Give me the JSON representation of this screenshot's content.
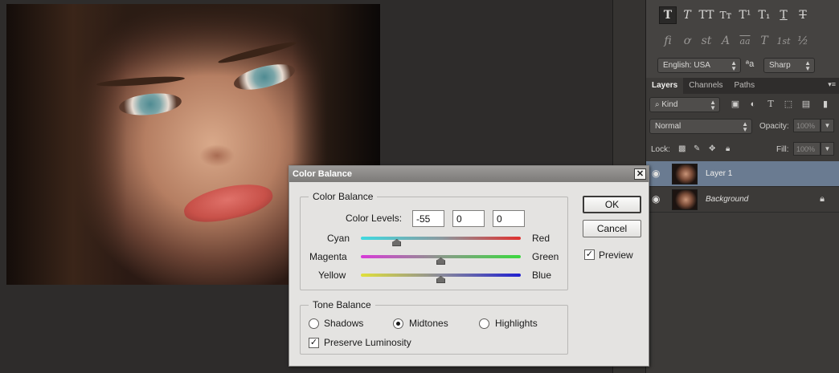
{
  "dialog": {
    "title": "Color Balance",
    "close_glyph": "✕",
    "color_balance_group": "Color Balance",
    "color_levels_label": "Color Levels:",
    "levels": [
      "-55",
      "0",
      "0"
    ],
    "sliders": [
      {
        "left": "Cyan",
        "right": "Red",
        "value": -55,
        "min": -100,
        "max": 100
      },
      {
        "left": "Magenta",
        "right": "Green",
        "value": 0,
        "min": -100,
        "max": 100
      },
      {
        "left": "Yellow",
        "right": "Blue",
        "value": 0,
        "min": -100,
        "max": 100
      }
    ],
    "tone_balance_group": "Tone Balance",
    "tones": {
      "shadows": "Shadows",
      "midtones": "Midtones",
      "highlights": "Highlights",
      "selected": "midtones"
    },
    "preserve_luminosity": "Preserve Luminosity",
    "preserve_luminosity_checked": true,
    "ok": "OK",
    "cancel": "Cancel",
    "preview": "Preview",
    "preview_checked": true
  },
  "character": {
    "row1": [
      "T",
      "T",
      "TT",
      "Tт",
      "T¹",
      "T₁",
      "T",
      "T"
    ],
    "row2": [
      "ﬁ",
      "ơ",
      "st",
      "A",
      "aa",
      "T",
      "1st",
      "½"
    ],
    "language": "English: USA",
    "aa_icon": "ªa",
    "antialias": "Sharp"
  },
  "layers_panel": {
    "tabs": [
      "Layers",
      "Channels",
      "Paths"
    ],
    "menu_glyph": "▾≡",
    "filter": "Kind",
    "filter_icon": "⌕",
    "blend_mode": "Normal",
    "opacity_label": "Opacity:",
    "opacity": "100%",
    "lock_label": "Lock:",
    "fill_label": "Fill:",
    "fill": "100%",
    "layers": [
      {
        "name": "Layer 1",
        "visible": true,
        "selected": true,
        "locked": false
      },
      {
        "name": "Background",
        "visible": true,
        "selected": false,
        "locked": true
      }
    ]
  },
  "colors": {
    "selected_layer": "#6a7b91",
    "dialog_bg": "#e4e3e1",
    "workspace": "#2e2c2b"
  }
}
